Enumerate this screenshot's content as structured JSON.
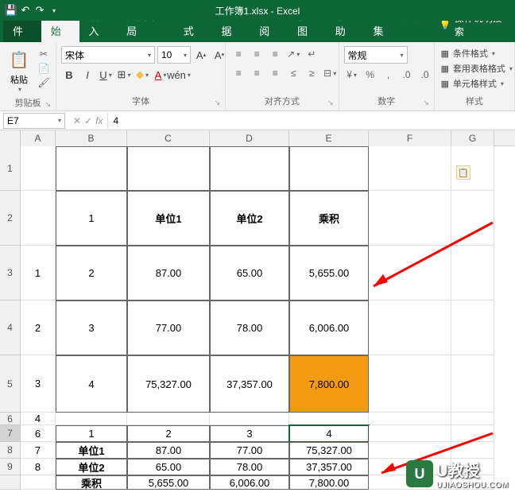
{
  "title": "工作簿1.xlsx - Excel",
  "tabs": {
    "file": "文件",
    "home": "开始",
    "insert": "插入",
    "pagelayout": "页面布局",
    "formulas": "公式",
    "data": "数据",
    "review": "审阅",
    "view": "视图",
    "help": "帮助",
    "pdf": "PDF工具集",
    "tell": "操作说明搜索"
  },
  "ribbon": {
    "paste": "粘贴",
    "clipboard": "剪贴板",
    "font": "字体",
    "fontname": "宋体",
    "fontsize": "10",
    "align": "对齐方式",
    "number": "数字",
    "numberformat": "常规",
    "styles": "样式",
    "condformat": "条件格式",
    "tableformat": "套用表格格式",
    "cellstyles": "单元格样式"
  },
  "formula_bar": {
    "name_box": "E7",
    "value": "4"
  },
  "columns": [
    "A",
    "B",
    "C",
    "D",
    "E",
    "F",
    "G"
  ],
  "rows": [
    "1",
    "2",
    "3",
    "4",
    "5",
    "6",
    "7",
    "8",
    "9",
    ""
  ],
  "data": {
    "r2": {
      "B": "1",
      "C": "单位1",
      "D": "单位2",
      "E": "乘积"
    },
    "r3": {
      "A": "1",
      "B": "2",
      "C": "87.00",
      "D": "65.00",
      "E": "5,655.00"
    },
    "r4": {
      "A": "2",
      "B": "3",
      "C": "77.00",
      "D": "78.00",
      "E": "6,006.00"
    },
    "r5": {
      "A": "3",
      "B": "4",
      "C": "75,327.00",
      "D": "37,357.00",
      "E": "7,800.00"
    },
    "r6": {
      "A": "4"
    },
    "r7": {
      "A": "6",
      "B": "1",
      "C": "2",
      "D": "3",
      "E": "4"
    },
    "r8": {
      "A": "7",
      "B": "单位1",
      "C": "87.00",
      "D": "77.00",
      "E": "75,327.00"
    },
    "r9": {
      "A": "8",
      "B": "单位2",
      "C": "65.00",
      "D": "78.00",
      "E": "37,357.00"
    },
    "r10": {
      "B": "乘积",
      "C": "5,655.00",
      "D": "6,006.00",
      "E": "7,800.00"
    }
  },
  "watermark": {
    "main": "U教授",
    "sub": "UJIAOSHOU.COM",
    "icon": "U"
  }
}
